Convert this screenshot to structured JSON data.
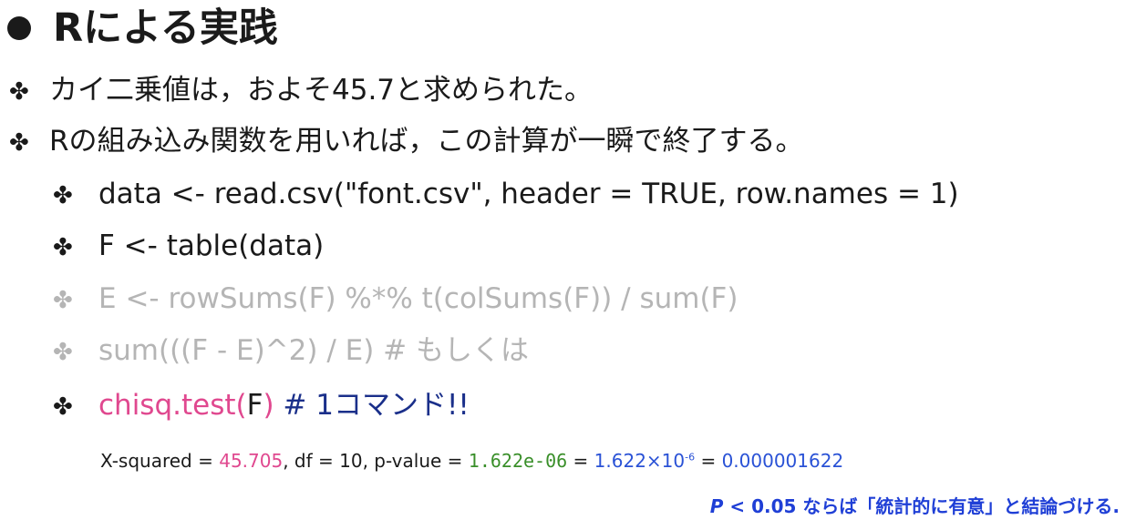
{
  "title": "Rによる実践",
  "bullet_symbol": "✤",
  "bullets": [
    "カイ二乗値は，およそ45.7と求められた。",
    "Rの組み込み関数を用いれば，この計算が一瞬で終了する。"
  ],
  "code": {
    "line1": "data <- read.csv(\"font.csv\", header = TRUE, row.names = 1)",
    "line2": "F <- table(data)",
    "line3": "E <- rowSums(F) %*% t(colSums(F)) / sum(F)",
    "line4": "sum(((F - E)^2) / E) # もしくは",
    "line5": {
      "func": "chisq.test(",
      "arg": "F",
      "close": ")",
      "comment": " # 1コマンド!!"
    }
  },
  "result": {
    "xsq_label": "X-squared = ",
    "xsq_value": "45.705",
    "df_text": ", df = 10, p-value = ",
    "pval": "1.622e-06",
    "eq1": " = ",
    "sci_base": "1.622×10",
    "sci_exp": "-6",
    "eq2": " = ",
    "decimal": "0.000001622"
  },
  "note": {
    "p": "P",
    "text": " < 0.05 ならば「統計的に有意」と結論づける."
  },
  "colors": {
    "pink": "#e0488f",
    "navy": "#1a2f8a",
    "green": "#3a8f2a",
    "blue": "#2a52d6",
    "grey": "#b5b5b5"
  }
}
